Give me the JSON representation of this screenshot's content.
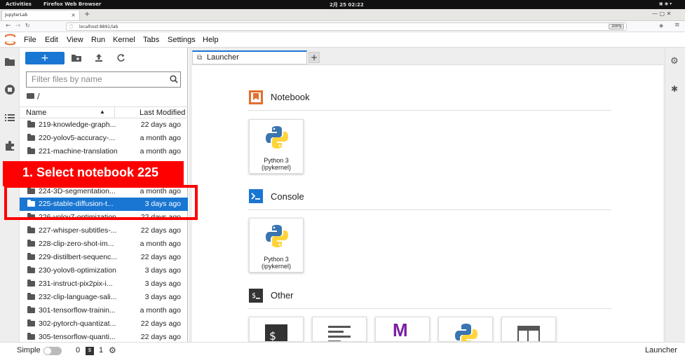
{
  "gnome": {
    "activities": "Activities",
    "app": "Firefox Web Browser",
    "clock": "2月 25 02:22"
  },
  "browser": {
    "tab_title": "JupyterLab",
    "url": "localhost:8891/lab",
    "zoom": "206%"
  },
  "menubar": {
    "items": [
      "File",
      "Edit",
      "View",
      "Run",
      "Kernel",
      "Tabs",
      "Settings",
      "Help"
    ]
  },
  "filebrowser": {
    "new_label": "+",
    "filter_placeholder": "Filter files by name",
    "breadcrumb": "/",
    "col_name": "Name",
    "col_modified": "Last Modified",
    "rows": [
      {
        "name": "219-knowledge-graph...",
        "date": "22 days ago"
      },
      {
        "name": "220-yolov5-accuracy-...",
        "date": "a month ago"
      },
      {
        "name": "221-machine-translation",
        "date": "a month ago"
      },
      {
        "name": "224-3D-segmentation...",
        "date": "a month ago"
      },
      {
        "name": "225-stable-diffusion-t...",
        "date": "3 days ago"
      },
      {
        "name": "226-yolov7-optimization",
        "date": "22 days ago"
      },
      {
        "name": "227-whisper-subtitles-...",
        "date": "22 days ago"
      },
      {
        "name": "228-clip-zero-shot-im...",
        "date": "a month ago"
      },
      {
        "name": "229-distilbert-sequenc...",
        "date": "22 days ago"
      },
      {
        "name": "230-yolov8-optimization",
        "date": "3 days ago"
      },
      {
        "name": "231-instruct-pix2pix-i...",
        "date": "3 days ago"
      },
      {
        "name": "232-clip-language-sali...",
        "date": "3 days ago"
      },
      {
        "name": "301-tensorflow-trainin...",
        "date": "a month ago"
      },
      {
        "name": "302-pytorch-quantizat...",
        "date": "22 days ago"
      },
      {
        "name": "305-tensorflow-quanti...",
        "date": "22 days ago"
      }
    ]
  },
  "main": {
    "tab_label": "Launcher",
    "sections": {
      "notebook": "Notebook",
      "console": "Console",
      "other": "Other"
    },
    "kernel_card": {
      "line1": "Python 3",
      "line2": "(ipykernel)"
    }
  },
  "callout": "1. Select notebook 225",
  "status": {
    "mode": "Simple",
    "kernels": "0",
    "terminals": "1",
    "right": "Launcher"
  },
  "colors": {
    "accent": "#1976d2",
    "callout": "#ff0000",
    "jupyter_orange": "#e46e2e"
  }
}
